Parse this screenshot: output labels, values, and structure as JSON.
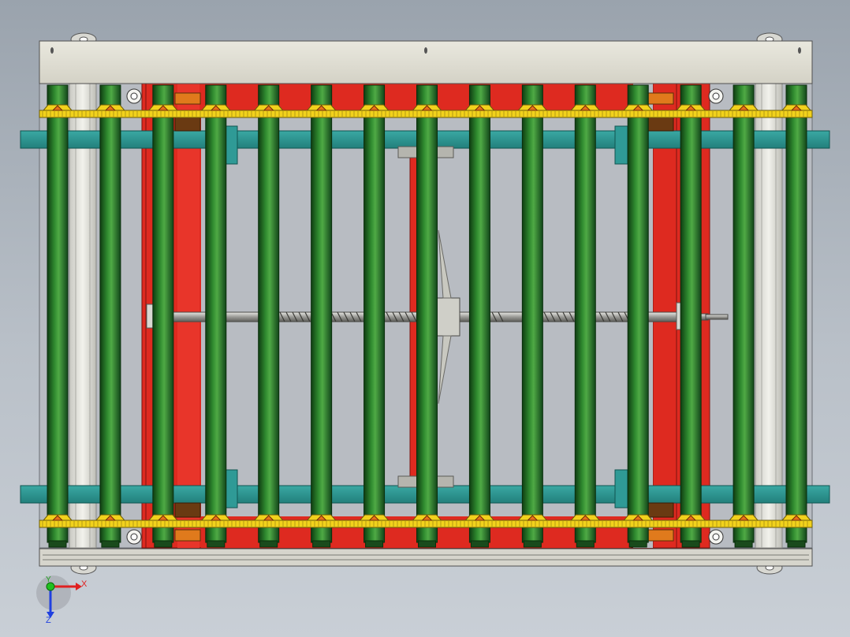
{
  "viewport": {
    "background_top": "#9aa3ad",
    "background_bottom": "#c9cfd6"
  },
  "assembly": {
    "roller_count": 15,
    "roller_color": "#2f7a2f",
    "frame_color": "#de2a20",
    "crossbar_color": "#2f9a96",
    "sprocket_color": "#f2d21c",
    "end_plate_color": "#e2e0d4",
    "bearing_block_color": "#e07a1c"
  },
  "triad": {
    "x_label": "X",
    "y_label": "Y",
    "z_label": "Z",
    "x_color": "#e02020",
    "y_color": "#20c020",
    "z_color": "#2040e0"
  }
}
